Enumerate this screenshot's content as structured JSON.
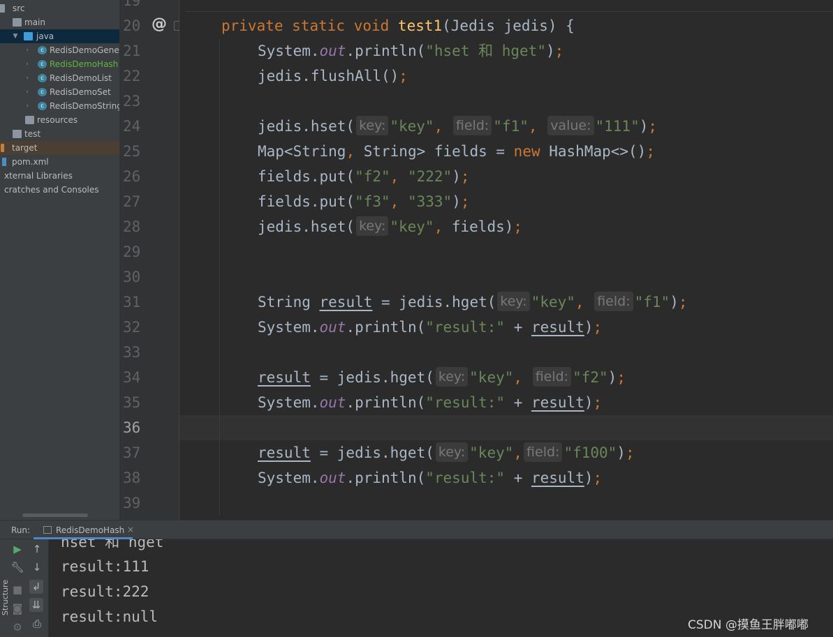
{
  "project_tree": {
    "items": [
      {
        "label": "src",
        "icon": "folder-icon"
      },
      {
        "label": "main",
        "icon": "folder-icon"
      },
      {
        "label": "java",
        "icon": "source-folder-icon"
      },
      {
        "label": "RedisDemoGener",
        "icon": "class-icon"
      },
      {
        "label": "RedisDemoHash",
        "icon": "class-icon"
      },
      {
        "label": "RedisDemoList",
        "icon": "class-icon"
      },
      {
        "label": "RedisDemoSet",
        "icon": "class-icon"
      },
      {
        "label": "RedisDemoString",
        "icon": "class-icon"
      },
      {
        "label": "resources",
        "icon": "resources-folder-icon"
      },
      {
        "label": "test",
        "icon": "folder-icon"
      },
      {
        "label": "target",
        "icon": "excluded-folder-icon"
      },
      {
        "label": "pom.xml",
        "icon": "maven-icon"
      },
      {
        "label": "xternal Libraries",
        "icon": "libraries-icon"
      },
      {
        "label": "cratches and Consoles",
        "icon": "scratches-icon"
      }
    ]
  },
  "editor": {
    "line_numbers": [
      "19",
      "20",
      "21",
      "22",
      "23",
      "24",
      "25",
      "26",
      "27",
      "28",
      "29",
      "30",
      "31",
      "32",
      "33",
      "34",
      "35",
      "36",
      "37",
      "38",
      "39"
    ],
    "gutter_override_symbol": "@",
    "code": {
      "l20": {
        "mod1": "private",
        "mod2": "static",
        "type": "void",
        "method": "test1",
        "params": "(Jedis jedis) {"
      },
      "l21": {
        "a": "System.",
        "field": "out",
        "b": ".println(",
        "str": "\"hset 和 hget\"",
        "c": ")",
        "semi": ";"
      },
      "l22": {
        "a": "jedis.flushAll()",
        "semi": ";"
      },
      "l24": {
        "a": "jedis.hset(",
        "h1": "key:",
        "s1": "\"key\"",
        "c1": ",",
        "h2": "field:",
        "s2": "\"f1\"",
        "c2": ",",
        "h3": "value:",
        "s3": "\"111\"",
        "b": ")",
        "semi": ";"
      },
      "l25": {
        "a": "Map<String",
        "c1": ",",
        "b": " String> fields = ",
        "kw": "new",
        "c": " HashMap<>()",
        "semi": ";"
      },
      "l26": {
        "a": "fields.put(",
        "s1": "\"f2\"",
        "c1": ",",
        "s2": "\"222\"",
        "b": ")",
        "semi": ";"
      },
      "l27": {
        "a": "fields.put(",
        "s1": "\"f3\"",
        "c1": ",",
        "s2": "\"333\"",
        "b": ")",
        "semi": ";"
      },
      "l28": {
        "a": "jedis.hset(",
        "h1": "key:",
        "s1": "\"key\"",
        "c1": ",",
        "b": " fields)",
        "semi": ";"
      },
      "l31": {
        "a": "String ",
        "var": "result",
        "b": " = jedis.hget(",
        "h1": "key:",
        "s1": "\"key\"",
        "c1": ",",
        "h2": "field:",
        "s2": "\"f1\"",
        "c": ")",
        "semi": ";"
      },
      "l32": {
        "a": "System.",
        "field": "out",
        "b": ".println(",
        "str": "\"result:\"",
        "plus": " + ",
        "var": "result",
        "c": ")",
        "semi": ";"
      },
      "l34": {
        "var": "result",
        "b": " = jedis.hget(",
        "h1": "key:",
        "s1": "\"key\"",
        "c1": ",",
        "h2": "field:",
        "s2": "\"f2\"",
        "c": ")",
        "semi": ";"
      },
      "l35": {
        "a": "System.",
        "field": "out",
        "b": ".println(",
        "str": "\"result:\"",
        "plus": " + ",
        "var": "result",
        "c": ")",
        "semi": ";"
      },
      "l37": {
        "var": "result",
        "b": " = jedis.hget(",
        "h1": "key:",
        "s1": "\"key\"",
        "c1": ",",
        "h2": "field:",
        "s2": "\"f100\"",
        "c": ")",
        "semi": ";"
      },
      "l38": {
        "a": "System.",
        "field": "out",
        "b": ".println(",
        "str": "\"result:\"",
        "plus": " + ",
        "var": "result",
        "c": ")",
        "semi": ";"
      }
    }
  },
  "run_panel": {
    "label": "Run:",
    "tab_label": "RedisDemoHash",
    "tab_close": "×",
    "side_label": "Structure",
    "toolbar": [
      "run-icon",
      "up-arrow-icon",
      "wrench-icon",
      "down-arrow-icon",
      "stop-icon",
      "soft-wrap-icon",
      "camera-icon",
      "scroll-to-end-icon",
      "settings-icon",
      "print-icon"
    ],
    "console_lines": [
      "hset 和 hget",
      "result:111",
      "result:222",
      "result:null"
    ]
  },
  "watermark": "CSDN @摸鱼王胖嘟嘟",
  "colors": {
    "keyword": "#cc7832",
    "method": "#ffc66d",
    "string": "#6a8759",
    "static_field": "#9876aa",
    "default_text": "#a9b7c6",
    "background": "#2b2b2b"
  }
}
